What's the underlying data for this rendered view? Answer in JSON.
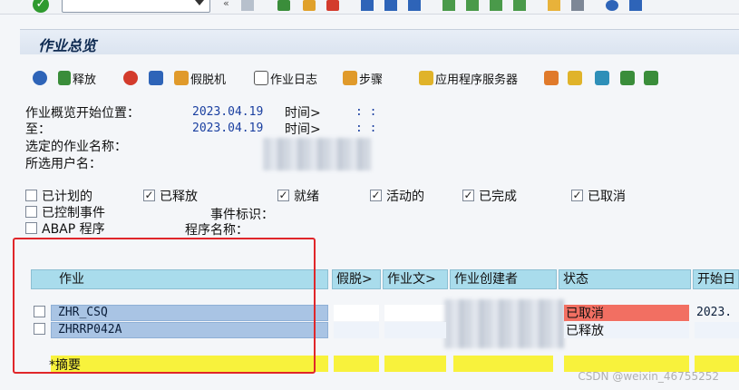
{
  "page_title": "作业总览",
  "toolbar_app": {
    "release": "释放",
    "spool": "假脱机",
    "job_log": "作业日志",
    "steps": "步骤",
    "app_server": "应用程序服务器"
  },
  "criteria": {
    "start_label": "作业概览开始位置：",
    "start_date": "2023.04.19",
    "start_time_label": "时间>",
    "start_time_value": ":  :",
    "to_label": "至：",
    "to_date": "2023.04.19",
    "to_time_label": "时间>",
    "to_time_value": ":  :",
    "job_name_label": "选定的作业名称：",
    "user_name_label": "所选用户名："
  },
  "status_filters": [
    {
      "label": "已计划的",
      "checked": false
    },
    {
      "label": "已释放",
      "checked": true
    },
    {
      "label": "就绪",
      "checked": true
    },
    {
      "label": "活动的",
      "checked": true
    },
    {
      "label": "已完成",
      "checked": true
    },
    {
      "label": "已取消",
      "checked": true
    }
  ],
  "event_filters": {
    "ctrl_event_label": "已控制事件",
    "event_id_label": "事件标识：",
    "abap_label": "ABAP 程序",
    "program_name_label": "程序名称："
  },
  "grid": {
    "columns": [
      "作业",
      "假脱>",
      "作业文>",
      "作业创建者",
      "状态",
      "开始日"
    ],
    "rows": [
      {
        "job": "ZHR_CSQ",
        "status": "已取消",
        "start": "2023."
      },
      {
        "job": "ZHRRP042A",
        "status": "已释放",
        "start": ""
      }
    ],
    "summary_label": "*摘要"
  },
  "watermark": "CSDN @weixin_46755252",
  "colors": {
    "status_cancelled": "#f26f62",
    "selected_row": "#a9c4e4",
    "summary_row": "#f8f23c",
    "header": "#a9dcec",
    "highlight_box": "#e0262a"
  }
}
